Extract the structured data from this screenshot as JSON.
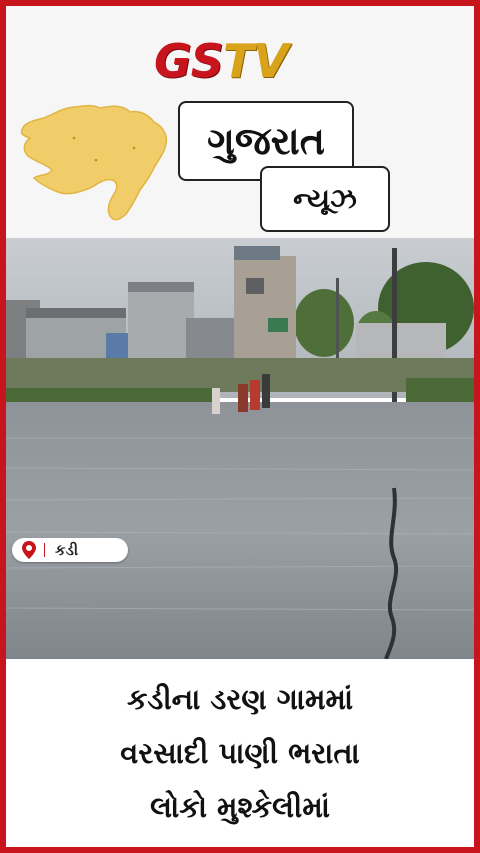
{
  "brand": {
    "logo_gs": "GS",
    "logo_tv": "TV",
    "primary_color": "#c8141c",
    "accent_color": "#d9a21b"
  },
  "header": {
    "title": "ગુજરાત",
    "subtitle": "ન્યૂઝ",
    "map_icon": "gujarat-map-icon"
  },
  "photo": {
    "location": "કડી",
    "location_icon": "map-pin-icon"
  },
  "caption": {
    "line1": "કડીના ડરણ ગામમાં",
    "line2": "વરસાદી પાણી ભરાતા",
    "line3": "લોકો મુશ્કેલીમાં"
  }
}
